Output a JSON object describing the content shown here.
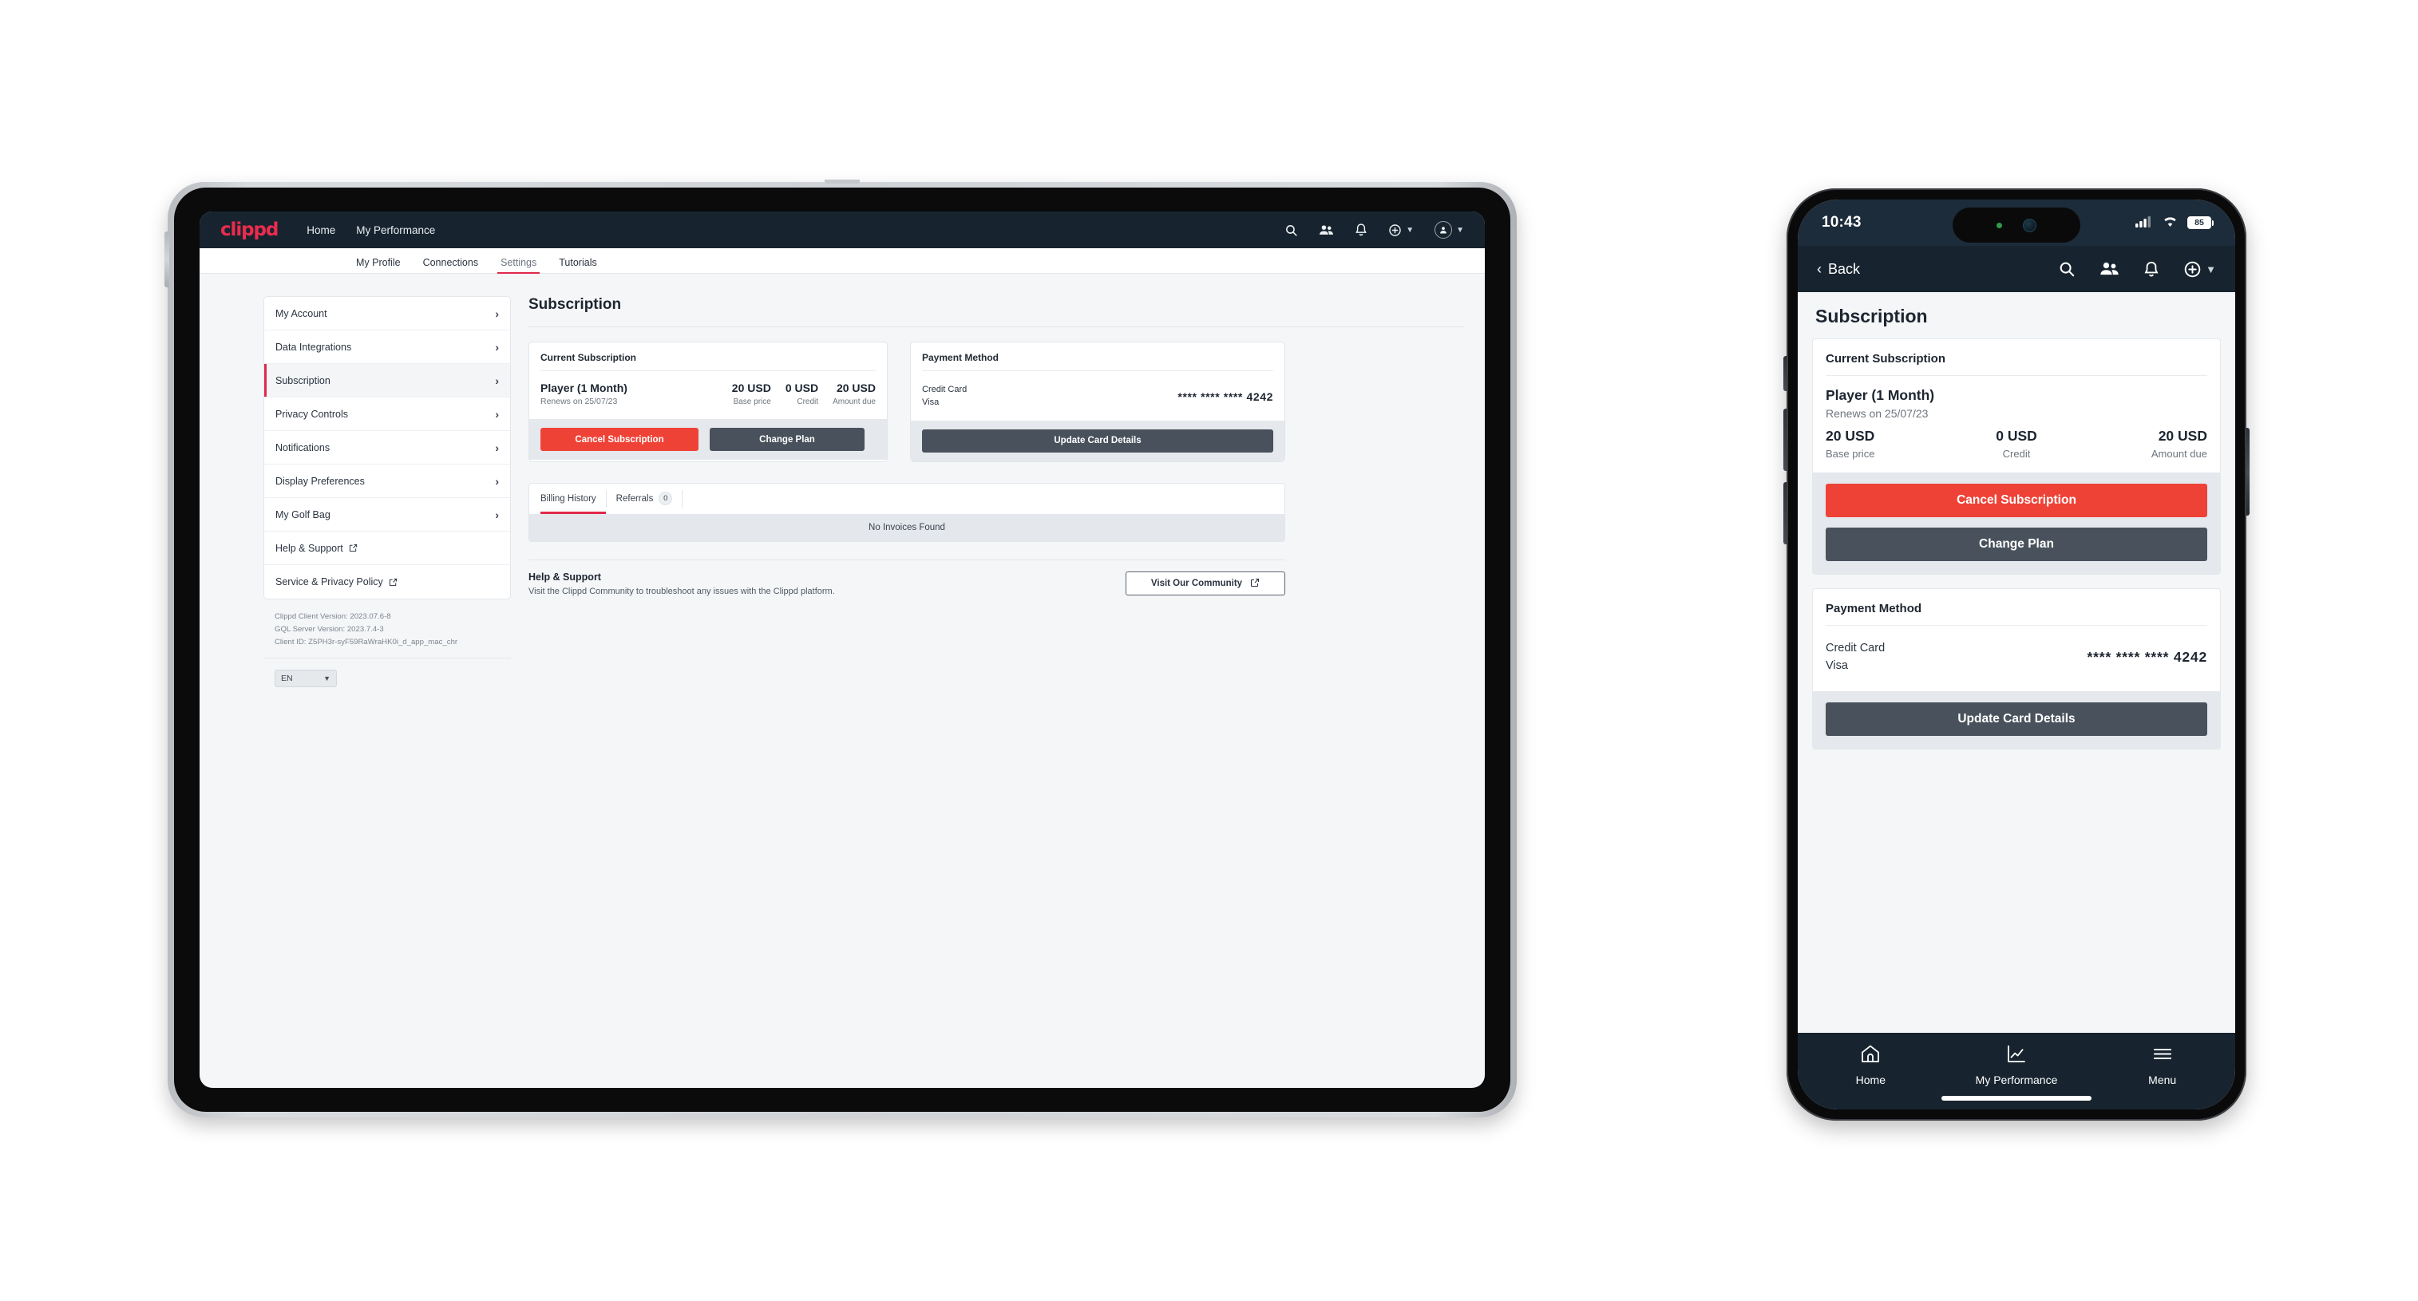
{
  "tablet": {
    "topbar": {
      "brand": "clippd",
      "nav": [
        {
          "label": "Home"
        },
        {
          "label": "My Performance"
        }
      ],
      "icons": [
        {
          "name": "search-icon"
        },
        {
          "name": "people-icon"
        },
        {
          "name": "bell-icon"
        },
        {
          "name": "plus-circle-icon"
        },
        {
          "name": "account-avatar-icon"
        }
      ]
    },
    "tabs": [
      {
        "label": "My Profile",
        "active": false
      },
      {
        "label": "Connections",
        "active": false
      },
      {
        "label": "Settings",
        "active": true
      },
      {
        "label": "Tutorials",
        "active": false
      }
    ],
    "sidebar": {
      "items": [
        {
          "label": "My Account",
          "selected": false,
          "external": false
        },
        {
          "label": "Data Integrations",
          "selected": false,
          "external": false
        },
        {
          "label": "Subscription",
          "selected": true,
          "external": false
        },
        {
          "label": "Privacy Controls",
          "selected": false,
          "external": false
        },
        {
          "label": "Notifications",
          "selected": false,
          "external": false
        },
        {
          "label": "Display Preferences",
          "selected": false,
          "external": false
        },
        {
          "label": "My Golf Bag",
          "selected": false,
          "external": false
        },
        {
          "label": "Help & Support",
          "selected": false,
          "external": true
        },
        {
          "label": "Service & Privacy Policy",
          "selected": false,
          "external": true
        }
      ],
      "version": {
        "client": "Clippd Client Version: 2023.07.6-8",
        "server": "GQL Server Version: 2023.7.4-3",
        "client_id": "Client ID: Z5PH3r-syF59RaWraHK0i_d_app_mac_chr"
      },
      "language": {
        "value": "EN"
      }
    },
    "main": {
      "page_title": "Subscription",
      "subscription_card": {
        "heading": "Current Subscription",
        "plan_name": "Player (1 Month)",
        "renew_text": "Renews on 25/07/23",
        "prices": [
          {
            "value": "20 USD",
            "label": "Base price"
          },
          {
            "value": "0 USD",
            "label": "Credit"
          },
          {
            "value": "20 USD",
            "label": "Amount due"
          }
        ],
        "cancel_label": "Cancel Subscription",
        "change_label": "Change Plan"
      },
      "payment_card": {
        "heading": "Payment Method",
        "card_type": "Credit Card",
        "card_brand": "Visa",
        "card_number": "**** **** **** 4242",
        "update_label": "Update Card Details"
      },
      "history": {
        "tabs": [
          {
            "label": "Billing History",
            "active": true,
            "count": null
          },
          {
            "label": "Referrals",
            "active": false,
            "count": "0"
          }
        ],
        "empty_text": "No Invoices Found"
      },
      "help": {
        "title": "Help & Support",
        "subtitle": "Visit the Clippd Community to troubleshoot any issues with the Clippd platform.",
        "button_label": "Visit Our Community"
      }
    }
  },
  "phone": {
    "status": {
      "time": "10:43",
      "battery": "85"
    },
    "nav": {
      "back_label": "Back",
      "icons": [
        {
          "name": "search-icon"
        },
        {
          "name": "people-icon"
        },
        {
          "name": "bell-icon"
        },
        {
          "name": "plus-circle-icon"
        }
      ]
    },
    "page_title": "Subscription",
    "subscription_card": {
      "heading": "Current Subscription",
      "plan_name": "Player (1 Month)",
      "renew_text": "Renews on 25/07/23",
      "prices": [
        {
          "value": "20 USD",
          "label": "Base price"
        },
        {
          "value": "0 USD",
          "label": "Credit"
        },
        {
          "value": "20 USD",
          "label": "Amount due"
        }
      ],
      "cancel_label": "Cancel Subscription",
      "change_label": "Change Plan"
    },
    "payment_card": {
      "heading": "Payment Method",
      "card_type": "Credit Card",
      "card_brand": "Visa",
      "card_number": "**** **** **** 4242",
      "update_label": "Update Card Details"
    },
    "tabbar": [
      {
        "label": "Home",
        "icon": "home-icon"
      },
      {
        "label": "My Performance",
        "icon": "chart-icon"
      },
      {
        "label": "Menu",
        "icon": "hamburger-icon"
      }
    ]
  },
  "colors": {
    "brand": "#ed2b4d",
    "navy": "#17242f",
    "danger": "#ef4237",
    "dark_button": "#49525c",
    "accent_underline": "#e0294b"
  }
}
